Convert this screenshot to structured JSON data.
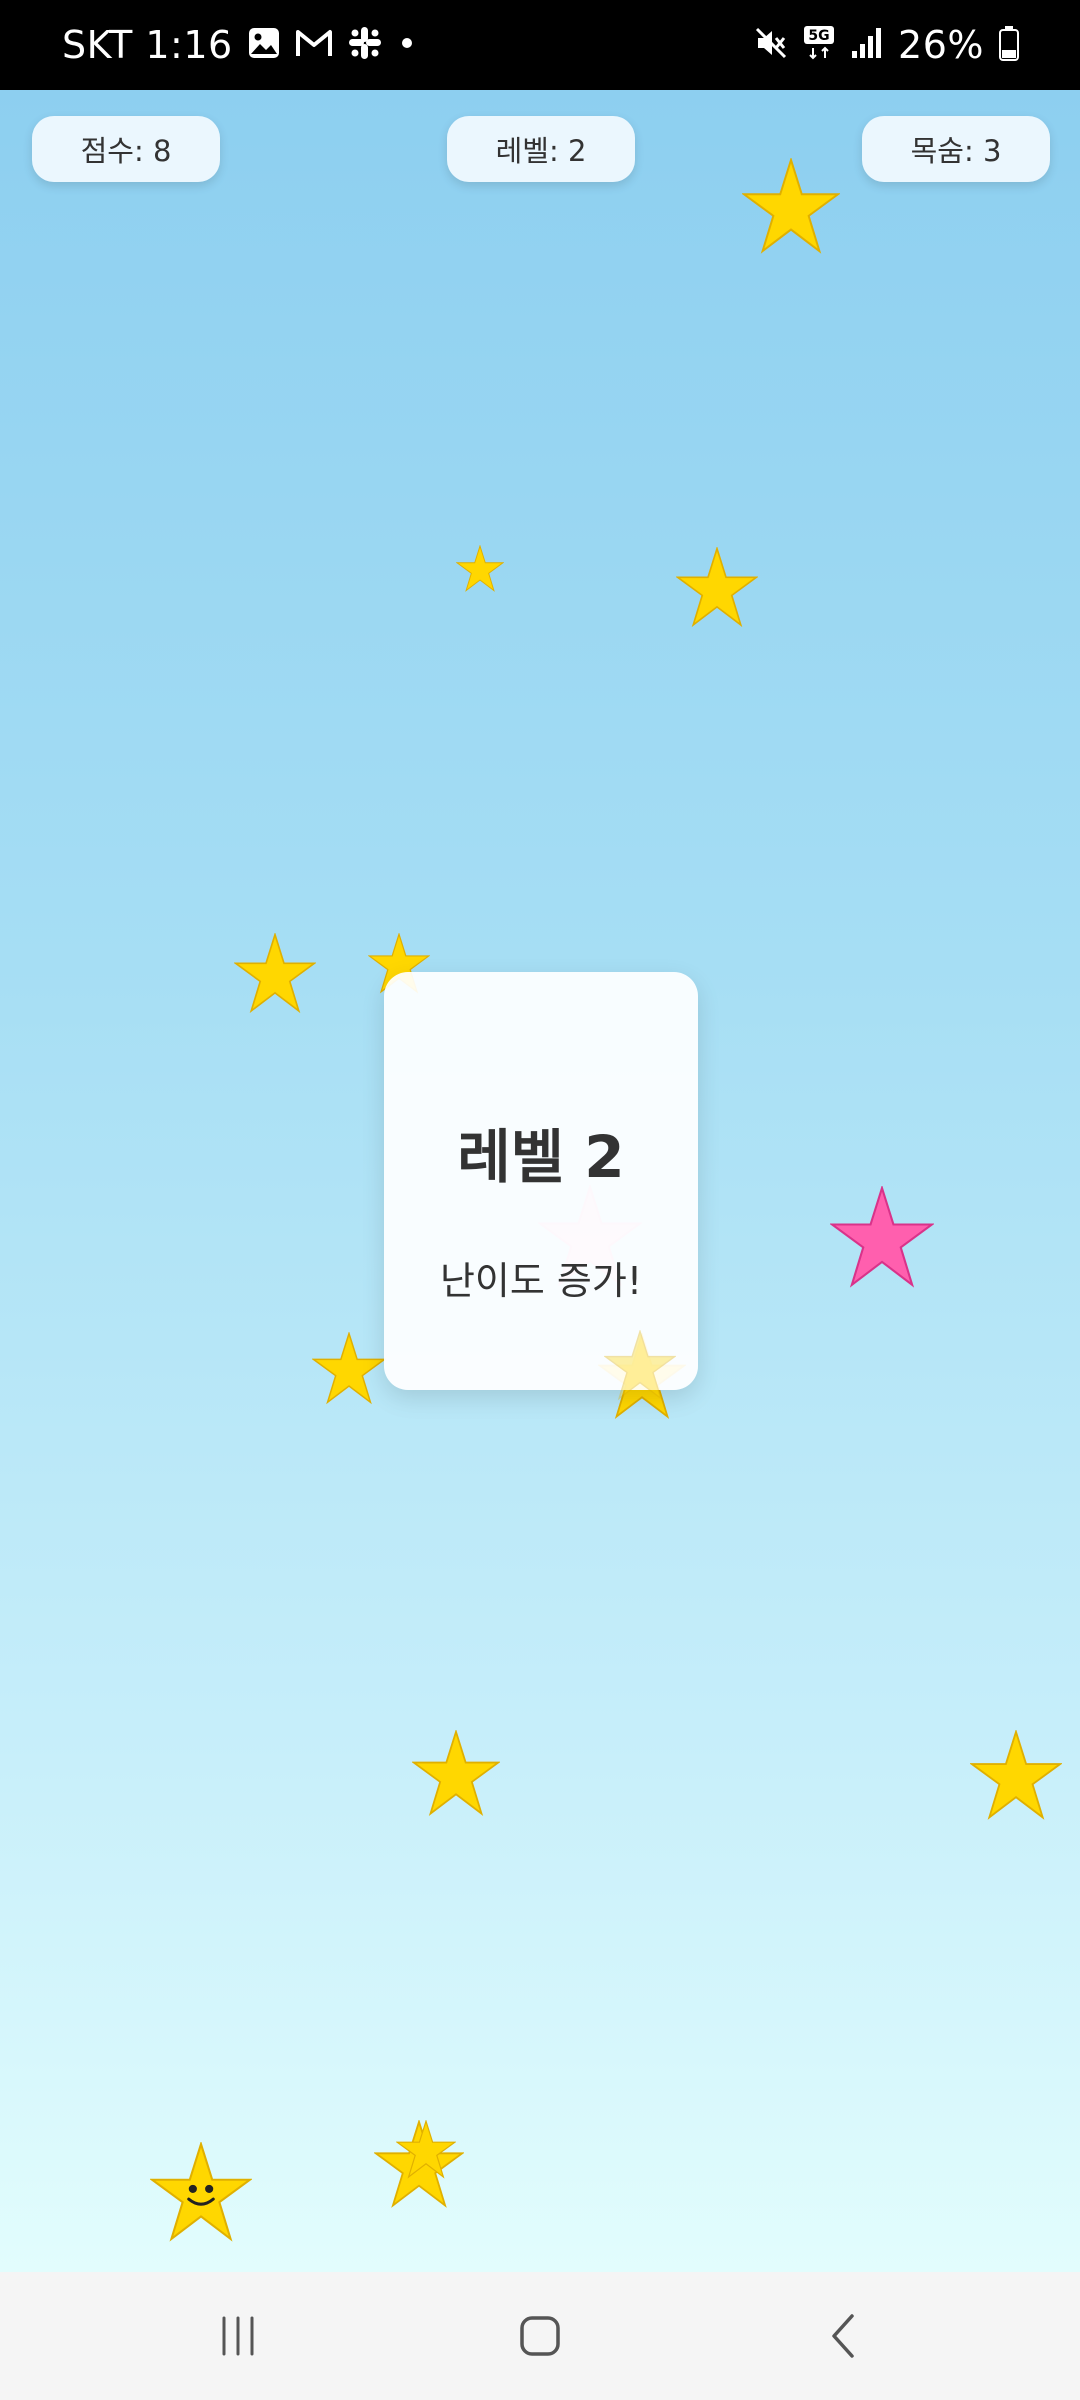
{
  "status_bar": {
    "carrier_time": "SKT 1:16",
    "battery": "26%",
    "icons": [
      "gallery-icon",
      "gmail-icon",
      "slack-icon",
      "notification-dot-icon",
      "mute-icon",
      "5g-icon",
      "signal-icon",
      "battery-icon"
    ]
  },
  "hud": {
    "score": "점수: 8",
    "level": "레벨: 2",
    "lives": "목숨: 3"
  },
  "dialog": {
    "title": "레벨 2",
    "subtitle": "난이도 증가!"
  },
  "colors": {
    "star_yellow": "#ffd700",
    "star_pink": "#ff5fae",
    "sky_top": "#8dcff0",
    "sky_bottom": "#e2fdfd"
  },
  "game_objects": {
    "player": "smiling-star",
    "falling_star_count_yellow": 13,
    "falling_star_count_pink": 1
  },
  "nav_bar": {
    "buttons": [
      "recent-apps",
      "home",
      "back"
    ]
  }
}
